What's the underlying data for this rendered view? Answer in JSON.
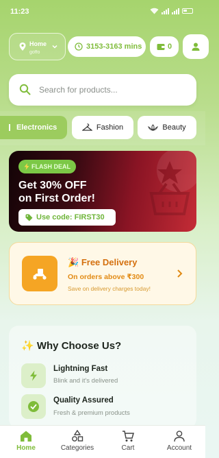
{
  "status_bar": {
    "time": "11:23"
  },
  "header": {
    "location_label": "Home",
    "location_sub": "goffo",
    "delivery_time": "3153-3163 mins",
    "wallet_balance": "0"
  },
  "search": {
    "placeholder": "Search for products..."
  },
  "categories": [
    {
      "label": "Electronics",
      "icon": "plug-icon",
      "active": true
    },
    {
      "label": "Fashion",
      "icon": "hanger-icon",
      "active": false
    },
    {
      "label": "Beauty",
      "icon": "lotus-icon",
      "active": false
    }
  ],
  "flash_deal": {
    "badge": "FLASH DEAL",
    "headline_line1": "Get 30% OFF",
    "headline_line2": "on First Order!",
    "code_text": "Use code: FIRST30"
  },
  "free_delivery": {
    "title": "Free Delivery",
    "subtitle": "On orders above ₹300",
    "note": "Save on delivery charges today!"
  },
  "why_choose": {
    "heading": "Why Choose Us?",
    "features": [
      {
        "title": "Lightning Fast",
        "subtitle": "Blink and it's delivered",
        "icon": "bolt-icon"
      },
      {
        "title": "Quality Assured",
        "subtitle": "Fresh & premium products",
        "icon": "check-badge-icon"
      }
    ]
  },
  "bottom_nav": [
    {
      "label": "Home",
      "icon": "home-icon",
      "active": true
    },
    {
      "label": "Categories",
      "icon": "shapes-icon",
      "active": false
    },
    {
      "label": "Cart",
      "icon": "cart-icon",
      "active": false
    },
    {
      "label": "Account",
      "icon": "person-icon",
      "active": false
    }
  ],
  "colors": {
    "brand_green": "#7fbc3a",
    "accent_orange": "#f5a524",
    "deal_red": "#c42c36"
  }
}
